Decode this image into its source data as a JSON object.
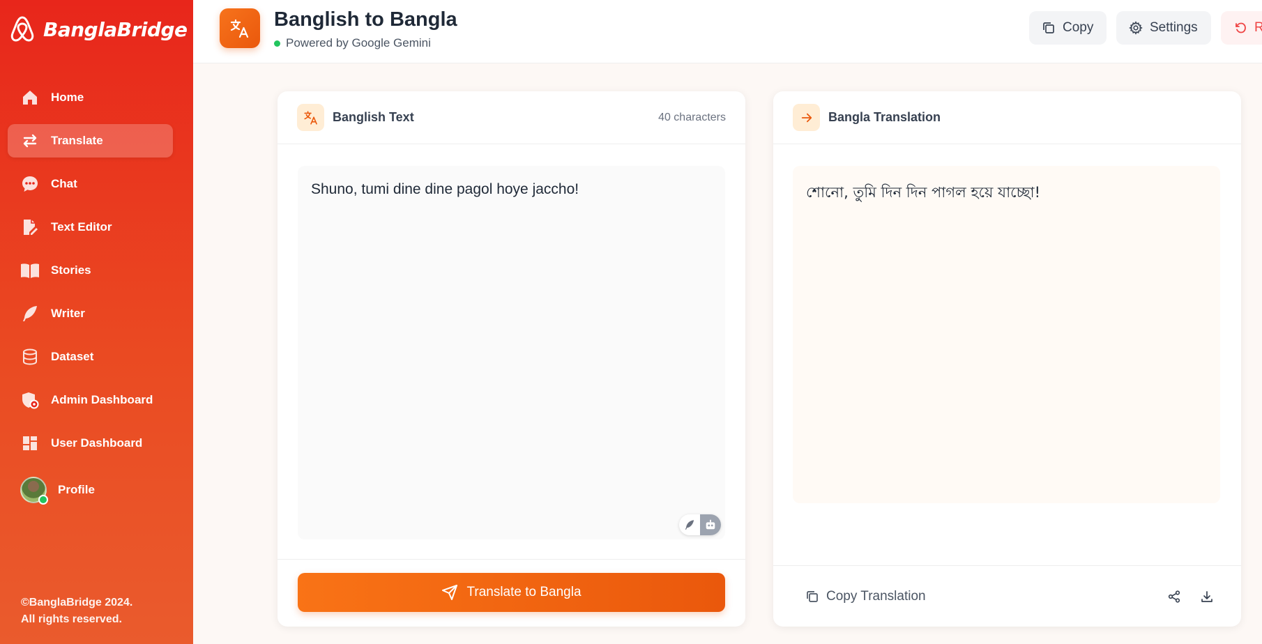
{
  "sidebar": {
    "brand": "BanglaBridge",
    "items": [
      {
        "label": "Home",
        "icon": "home-icon"
      },
      {
        "label": "Translate",
        "icon": "swap-arrows-icon",
        "active": true
      },
      {
        "label": "Chat",
        "icon": "chat-bubble-icon"
      },
      {
        "label": "Text Editor",
        "icon": "edit-document-icon"
      },
      {
        "label": "Stories",
        "icon": "open-book-icon"
      },
      {
        "label": "Writer",
        "icon": "feather-icon"
      },
      {
        "label": "Dataset",
        "icon": "database-icon"
      },
      {
        "label": "Admin Dashboard",
        "icon": "admin-shield-icon"
      },
      {
        "label": "User Dashboard",
        "icon": "dashboard-grid-icon"
      }
    ],
    "profile_label": "Profile",
    "copyright_line1": "©BanglaBridge 2024.",
    "copyright_line2": "All rights reserved."
  },
  "header": {
    "title": "Banglish to Bangla",
    "subtitle": "Powered by Google Gemini",
    "copy_label": "Copy",
    "settings_label": "Settings",
    "reset_label": "R"
  },
  "input_panel": {
    "title": "Banglish Text",
    "char_count": "40 characters",
    "text": "Shuno, tumi dine dine pagol hoye jaccho!",
    "button_label": "Translate to Bangla"
  },
  "output_panel": {
    "title": "Bangla Translation",
    "text": "শোনো, তুমি দিন দিন পাগল হয়ে যাচ্ছো!",
    "copy_label": "Copy Translation"
  },
  "colors": {
    "brand_red": "#e8261b",
    "accent_orange": "#ea580c",
    "online_green": "#22c55e"
  }
}
